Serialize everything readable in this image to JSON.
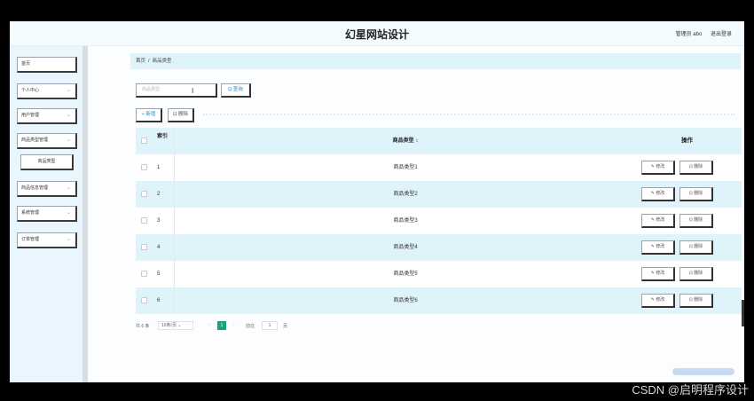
{
  "header": {
    "title": "幻星网站设计",
    "user": "管理员 abo",
    "logout": "退出登录"
  },
  "sidebar": {
    "items": [
      {
        "label": "首页",
        "has_chevron": false
      },
      {
        "label": "个人中心",
        "has_chevron": true
      },
      {
        "label": "用户管理",
        "has_chevron": true
      },
      {
        "label": "商品类型管理",
        "has_chevron": true
      },
      {
        "label": "商品类型",
        "sub": true
      },
      {
        "label": "商品信息管理",
        "has_chevron": true
      },
      {
        "label": "系统管理",
        "has_chevron": true
      },
      {
        "label": "订单管理",
        "has_chevron": true
      }
    ]
  },
  "breadcrumb": {
    "home": "首页",
    "sep": "/",
    "current": "商品类型"
  },
  "search": {
    "placeholder": "商品类型",
    "button": "Q 查询"
  },
  "toolbar": {
    "add": "+ 新增",
    "delete": "⊡ 删除"
  },
  "table": {
    "headers": {
      "index": "索引",
      "type": "商品类型 ↕",
      "ops": "操作"
    },
    "edit_label": "✎ 修改",
    "delete_label": "⊡ 删除",
    "rows": [
      {
        "index": "1",
        "type": "商品类型1"
      },
      {
        "index": "2",
        "type": "商品类型2"
      },
      {
        "index": "3",
        "type": "商品类型3"
      },
      {
        "index": "4",
        "type": "商品类型4"
      },
      {
        "index": "5",
        "type": "商品类型5"
      },
      {
        "index": "6",
        "type": "商品类型6"
      }
    ]
  },
  "pagination": {
    "total": "共 6 条",
    "page_size": "10条/页",
    "current_page": "1",
    "goto": "前往",
    "jump_value": "1",
    "unit": "页"
  },
  "watermark": "CSDN @启明程序设计"
}
